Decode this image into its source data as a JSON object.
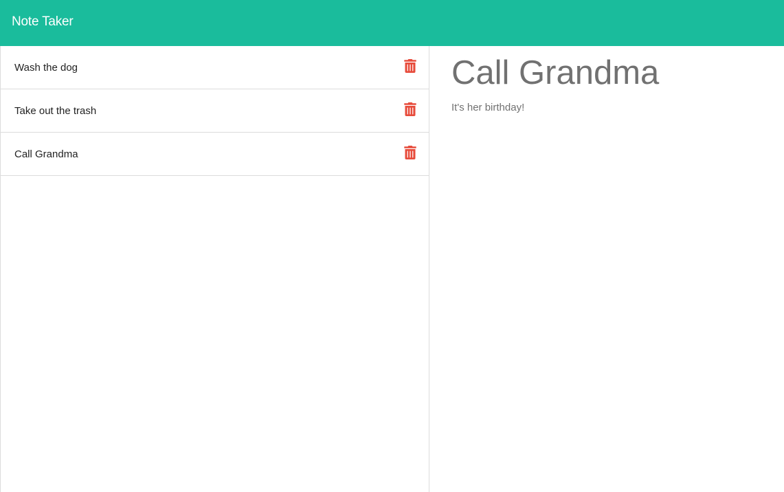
{
  "app": {
    "title": "Note Taker",
    "accent_color": "#1abc9c",
    "delete_color": "#e74c3c"
  },
  "notes": [
    {
      "title": "Wash the dog",
      "action_icon": "trash-icon"
    },
    {
      "title": "Take out the trash",
      "action_icon": "trash-icon"
    },
    {
      "title": "Call Grandma",
      "action_icon": "trash-icon"
    }
  ],
  "active_note": {
    "title": "Call Grandma",
    "text": "It's her birthday!"
  }
}
